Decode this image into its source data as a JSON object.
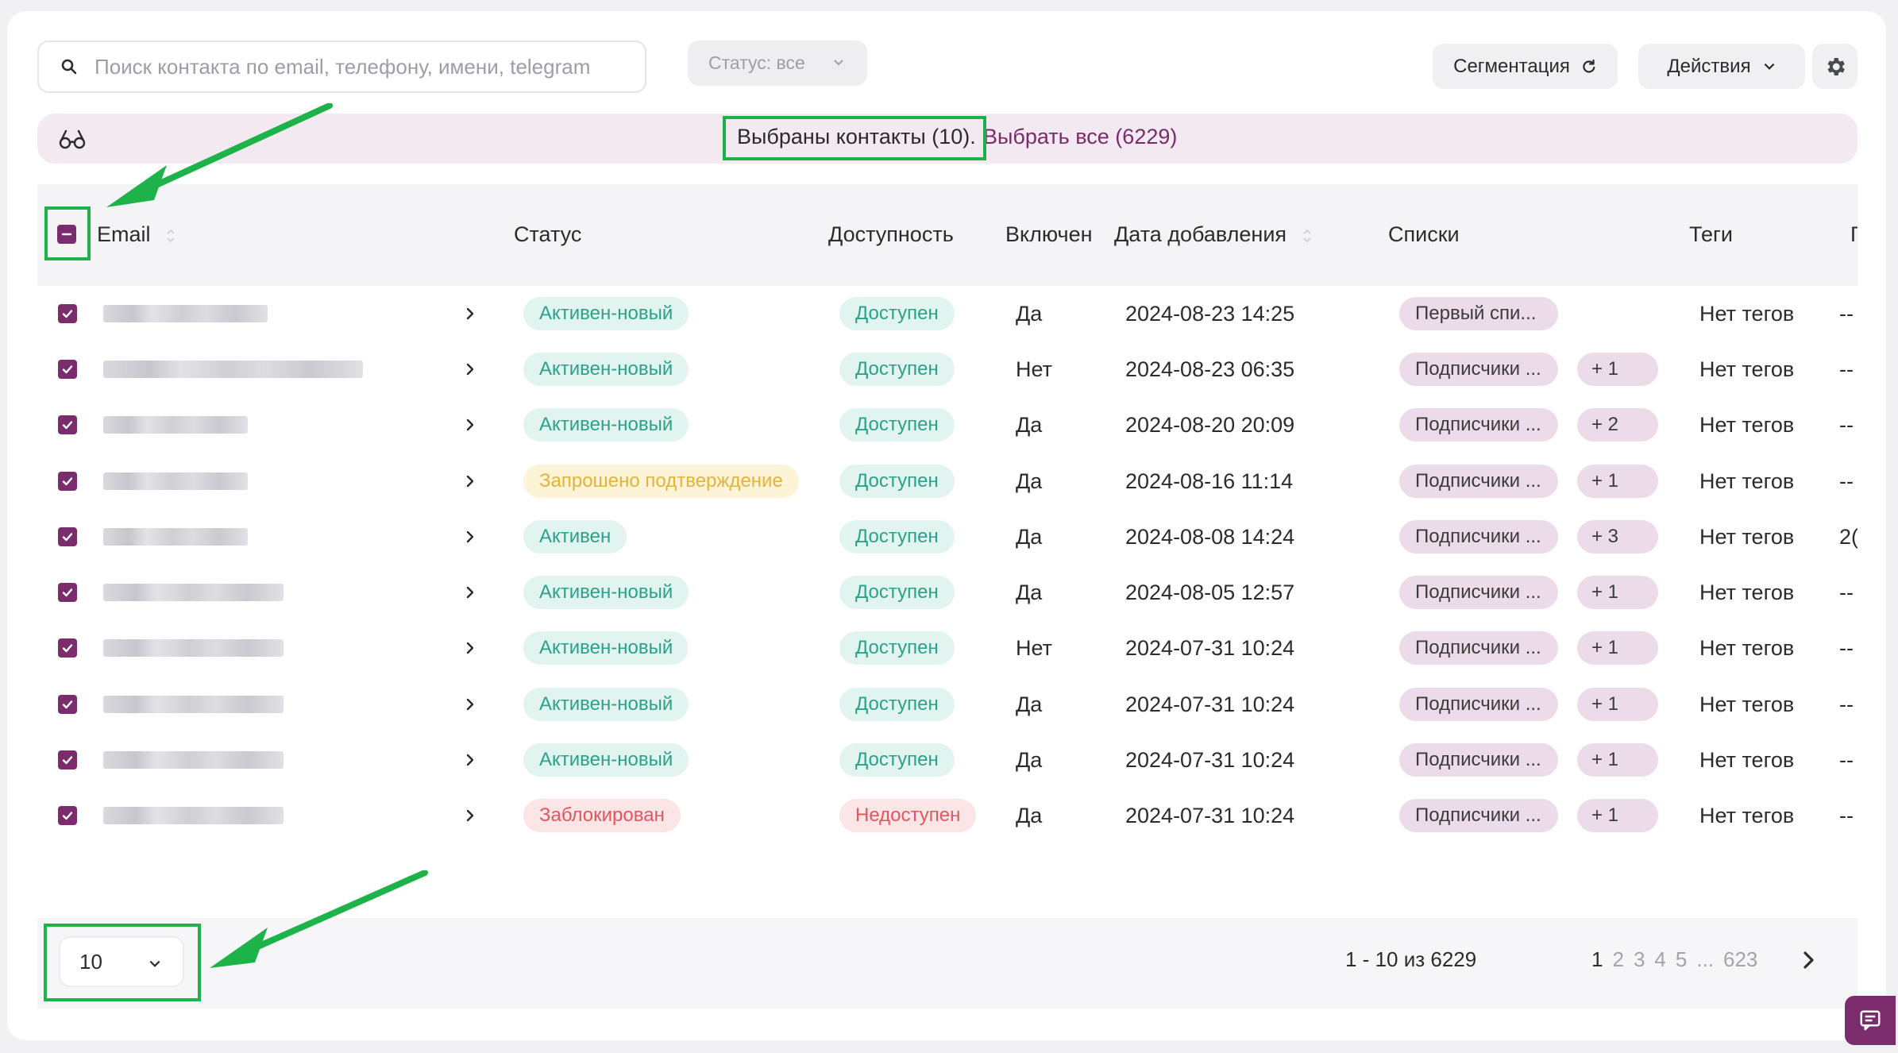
{
  "search": {
    "placeholder": "Поиск контакта по email, телефону, имени, telegram"
  },
  "status_filter": {
    "label": "Статус: все"
  },
  "toolbar": {
    "segmentation_label": "Сегментация",
    "actions_label": "Действия"
  },
  "selection": {
    "selected_text": "Выбраны контакты (10).",
    "select_all_text": "Выбрать все (6229)"
  },
  "columns": {
    "email": "Email",
    "status": "Статус",
    "availability": "Доступность",
    "enabled": "Включен",
    "date_added": "Дата добавления",
    "lists": "Списки",
    "tags": "Теги",
    "extra": "Г"
  },
  "rows": [
    {
      "status": "Активен-новый",
      "status_kind": "active",
      "availability": "Доступен",
      "avail_kind": "avail",
      "enabled": "Да",
      "date": "2024-08-23 14:25",
      "list": "Первый спи...",
      "plus": "",
      "tags": "Нет тегов",
      "extra": "--"
    },
    {
      "status": "Активен-новый",
      "status_kind": "active",
      "availability": "Доступен",
      "avail_kind": "avail",
      "enabled": "Нет",
      "date": "2024-08-23 06:35",
      "list": "Подписчики ...",
      "plus": "+ 1",
      "tags": "Нет тегов",
      "extra": "--"
    },
    {
      "status": "Активен-новый",
      "status_kind": "active",
      "availability": "Доступен",
      "avail_kind": "avail",
      "enabled": "Да",
      "date": "2024-08-20 20:09",
      "list": "Подписчики ...",
      "plus": "+ 2",
      "tags": "Нет тегов",
      "extra": "--"
    },
    {
      "status": "Запрошено подтверждение",
      "status_kind": "pending",
      "availability": "Доступен",
      "avail_kind": "avail",
      "enabled": "Да",
      "date": "2024-08-16 11:14",
      "list": "Подписчики ...",
      "plus": "+ 1",
      "tags": "Нет тегов",
      "extra": "--"
    },
    {
      "status": "Активен",
      "status_kind": "active",
      "availability": "Доступен",
      "avail_kind": "avail",
      "enabled": "Да",
      "date": "2024-08-08 14:24",
      "list": "Подписчики ...",
      "plus": "+ 3",
      "tags": "Нет тегов",
      "extra": "2("
    },
    {
      "status": "Активен-новый",
      "status_kind": "active",
      "availability": "Доступен",
      "avail_kind": "avail",
      "enabled": "Да",
      "date": "2024-08-05 12:57",
      "list": "Подписчики ...",
      "plus": "+ 1",
      "tags": "Нет тегов",
      "extra": "--"
    },
    {
      "status": "Активен-новый",
      "status_kind": "active",
      "availability": "Доступен",
      "avail_kind": "avail",
      "enabled": "Нет",
      "date": "2024-07-31 10:24",
      "list": "Подписчики ...",
      "plus": "+ 1",
      "tags": "Нет тегов",
      "extra": "--"
    },
    {
      "status": "Активен-новый",
      "status_kind": "active",
      "availability": "Доступен",
      "avail_kind": "avail",
      "enabled": "Да",
      "date": "2024-07-31 10:24",
      "list": "Подписчики ...",
      "plus": "+ 1",
      "tags": "Нет тегов",
      "extra": "--"
    },
    {
      "status": "Активен-новый",
      "status_kind": "active",
      "availability": "Доступен",
      "avail_kind": "avail",
      "enabled": "Да",
      "date": "2024-07-31 10:24",
      "list": "Подписчики ...",
      "plus": "+ 1",
      "tags": "Нет тегов",
      "extra": "--"
    },
    {
      "status": "Заблокирован",
      "status_kind": "blocked",
      "availability": "Недоступен",
      "avail_kind": "unavail",
      "enabled": "Да",
      "date": "2024-07-31 10:24",
      "list": "Подписчики ...",
      "plus": "+ 1",
      "tags": "Нет тегов",
      "extra": "--"
    }
  ],
  "pagination": {
    "page_size": "10",
    "range": "1 - 10 из 6229",
    "pages": [
      "1",
      "2",
      "3",
      "4",
      "5",
      "...",
      "623"
    ],
    "current": "1"
  },
  "colors": {
    "accent": "#7a2c6d",
    "highlight": "#1db24a"
  }
}
